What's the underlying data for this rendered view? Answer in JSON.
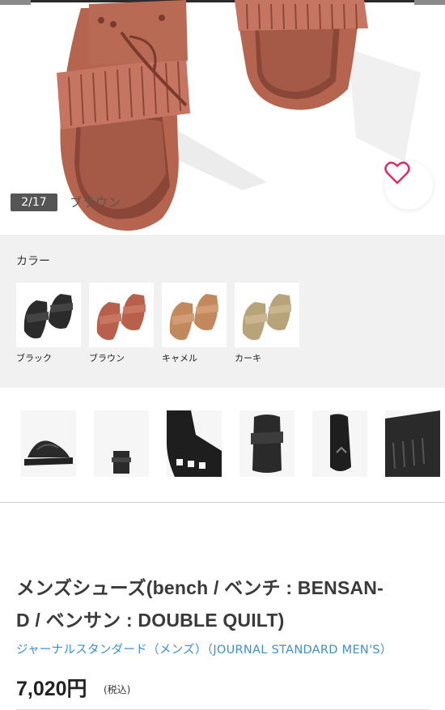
{
  "gallery": {
    "counter": "2/17",
    "selected_color": "ブラウン"
  },
  "colors": {
    "heading": "カラー",
    "items": [
      {
        "label": "ブラック",
        "color": "#2b2b2b",
        "icon": "black-sandal-swatch"
      },
      {
        "label": "ブラウン",
        "color": "#b9604d",
        "icon": "brown-sandal-swatch"
      },
      {
        "label": "キャメル",
        "color": "#c28a5c",
        "icon": "camel-sandal-swatch"
      },
      {
        "label": "カーキ",
        "color": "#b8a47a",
        "icon": "khaki-sandal-swatch"
      }
    ]
  },
  "thumbnails": [
    "side-view",
    "back-view",
    "sole-closeup",
    "top-view",
    "bottom-view",
    "fringe-closeup"
  ],
  "product": {
    "title_line1": "メンズシューズ(bench / ベンチ : BENSAN-",
    "title_line2": "D / ベンサン : DOUBLE QUILT)",
    "brand": "ジャーナルスタンダード（メンズ）（JOURNAL STANDARD MEN'S）",
    "price": "7,020円",
    "tax_note": "(税込)"
  },
  "accent": {
    "heart": "#d6336c",
    "link": "#3d8fd0"
  }
}
